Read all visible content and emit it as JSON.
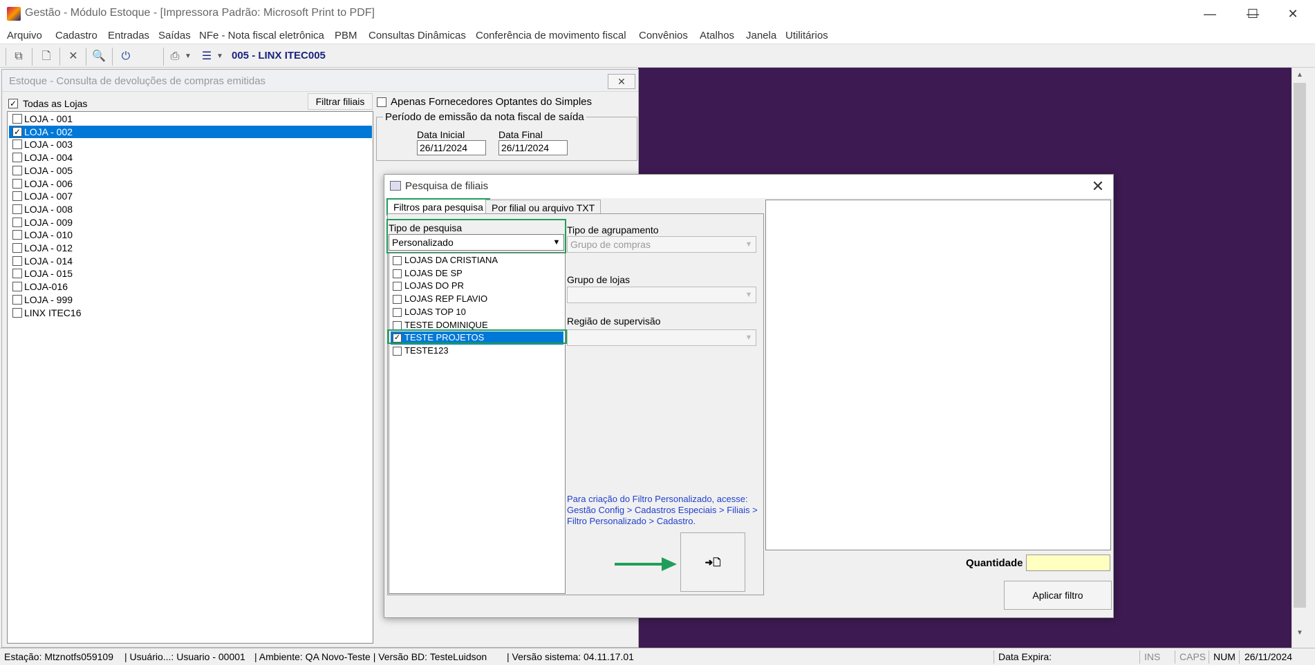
{
  "window": {
    "title": "Gestão  - Módulo Estoque - [Impressora Padrão: Microsoft Print to PDF]",
    "minimize": "—",
    "maximize": "☐",
    "close": "✕"
  },
  "menu": [
    "Arquivo",
    "Cadastro",
    "Entradas",
    "Saídas",
    "NFe - Nota fiscal eletrônica",
    "PBM",
    "Consultas Dinâmicas",
    "Conferência de movimento fiscal",
    "Convênios",
    "Atalhos",
    "Janela",
    "Utilitários"
  ],
  "toolbar": {
    "company": "005 - LINX ITEC005"
  },
  "estoque": {
    "title": "Estoque - Consulta  de devoluções de compras emitidas",
    "close_label": "✕",
    "todas_lojas": "Todas as Lojas",
    "filtrar_filiais": "Filtrar filiais",
    "apenas_fornecedores": "Apenas Fornecedores Optantes do Simples",
    "periodo_label": "Período de emissão da nota fiscal de saída",
    "data_inicial_label": "Data Inicial",
    "data_inicial": "26/11/2024",
    "data_final_label": "Data Final",
    "data_final": "26/11/2024",
    "lojas": [
      {
        "label": "LOJA - 001",
        "checked": false,
        "selected": false
      },
      {
        "label": "LOJA - 002",
        "checked": true,
        "selected": true
      },
      {
        "label": "LOJA - 003",
        "checked": false,
        "selected": false
      },
      {
        "label": "LOJA - 004",
        "checked": false,
        "selected": false
      },
      {
        "label": "LOJA - 005",
        "checked": false,
        "selected": false
      },
      {
        "label": "LOJA - 006",
        "checked": false,
        "selected": false
      },
      {
        "label": "LOJA - 007",
        "checked": false,
        "selected": false
      },
      {
        "label": "LOJA - 008",
        "checked": false,
        "selected": false
      },
      {
        "label": "LOJA - 009",
        "checked": false,
        "selected": false
      },
      {
        "label": "LOJA - 010",
        "checked": false,
        "selected": false
      },
      {
        "label": "LOJA - 012",
        "checked": false,
        "selected": false
      },
      {
        "label": "LOJA - 014",
        "checked": false,
        "selected": false
      },
      {
        "label": "LOJA - 015",
        "checked": false,
        "selected": false
      },
      {
        "label": "LOJA-016",
        "checked": false,
        "selected": false
      },
      {
        "label": "LOJA - 999",
        "checked": false,
        "selected": false
      },
      {
        "label": "LINX ITEC16",
        "checked": false,
        "selected": false
      }
    ]
  },
  "dialog": {
    "title": "Pesquisa de filiais",
    "close_label": "✕",
    "tabs": [
      "Filtros para pesquisa",
      "Por filial ou arquivo TXT"
    ],
    "tipo_pesquisa_label": "Tipo de pesquisa",
    "tipo_pesquisa_value": "Personalizado",
    "filtros": [
      {
        "label": "LOJAS DA CRISTIANA",
        "checked": false,
        "selected": false
      },
      {
        "label": "LOJAS DE SP",
        "checked": false,
        "selected": false
      },
      {
        "label": "LOJAS DO PR",
        "checked": false,
        "selected": false
      },
      {
        "label": "LOJAS REP FLAVIO",
        "checked": false,
        "selected": false
      },
      {
        "label": "LOJAS TOP 10",
        "checked": false,
        "selected": false
      },
      {
        "label": "TESTE DOMINIQUE",
        "checked": false,
        "selected": false
      },
      {
        "label": "TESTE PROJETOS",
        "checked": true,
        "selected": true
      },
      {
        "label": "TESTE123",
        "checked": false,
        "selected": false
      }
    ],
    "tipo_agrupamento_label": "Tipo de agrupamento",
    "tipo_agrupamento_value": "Grupo de compras",
    "grupo_lojas_label": "Grupo de lojas",
    "grupo_lojas_value": "",
    "regiao_label": "Região de supervisão",
    "regiao_value": "",
    "info_text": "Para criação do Filtro Personalizado, acesse: Gestão Config > Cadastros Especiais > Filiais > Filtro Personalizado > Cadastro.",
    "go_button_icon": "➜🗋",
    "quantidade_label": "Quantidade",
    "quantidade_value": "",
    "aplicar_filtro": "Aplicar filtro",
    "accent_color": "#1e9e5a"
  },
  "status": {
    "estacao": "Estação: Mtznotfs059109",
    "usuario": "| Usuário...: Usuario - 00001",
    "ambiente": "| Ambiente: QA Novo-Teste | Versão BD: TesteLuidson",
    "versao": "| Versão sistema: 04.11.17.01",
    "data_expira": "Data Expira:",
    "ins": "INS",
    "caps": "CAPS",
    "num": "NUM",
    "date": "26/11/2024"
  }
}
